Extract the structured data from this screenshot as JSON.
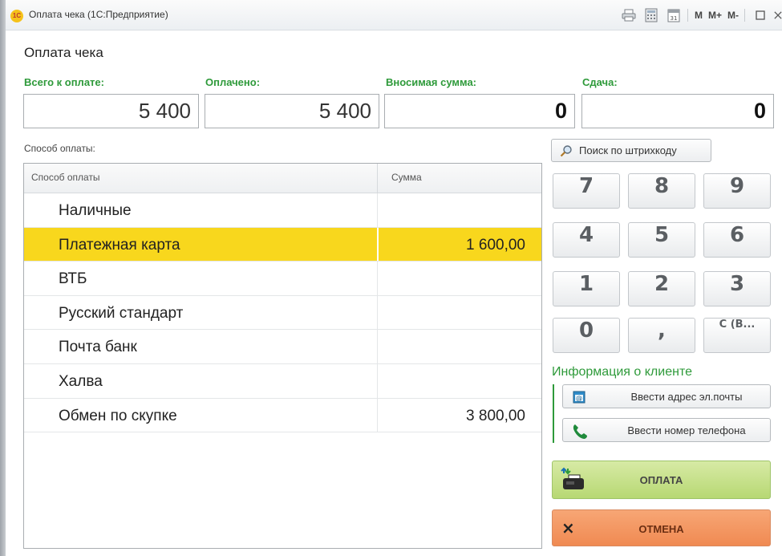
{
  "window": {
    "title": "Оплата чека  (1С:Предприятие)",
    "logo_text": "1С",
    "toolbar": [
      "print-icon",
      "calculator-icon",
      "calendar-icon"
    ],
    "memory": {
      "m": "M",
      "mplus": "M+",
      "mminus": "M-"
    },
    "maximize_icon": "maximize-icon",
    "close_icon": "close-icon"
  },
  "page": {
    "title": "Оплата чека"
  },
  "totals": {
    "total_label": "Всего к оплате:",
    "total_value": "5 400",
    "paid_label": "Оплачено:",
    "paid_value": "5 400",
    "deposit_label": "Вносимая сумма:",
    "deposit_value": "0",
    "change_label": "Сдача:",
    "change_value": "0"
  },
  "payment": {
    "section_label": "Способ оплаты:",
    "columns": {
      "method": "Способ оплаты",
      "amount": "Сумма"
    },
    "rows": [
      {
        "method": "Наличные",
        "amount": ""
      },
      {
        "method": "Платежная карта",
        "amount": "1 600,00",
        "selected": true
      },
      {
        "method": "ВТБ",
        "amount": ""
      },
      {
        "method": "Русский стандарт",
        "amount": ""
      },
      {
        "method": "Почта банк",
        "amount": ""
      },
      {
        "method": "Халва",
        "amount": ""
      },
      {
        "method": "Обмен по скупке",
        "amount": "3 800,00"
      }
    ]
  },
  "search": {
    "label": "Поиск по штрихкоду",
    "icon": "magnifier-icon"
  },
  "keypad": {
    "k7": "7",
    "k8": "8",
    "k9": "9",
    "k4": "4",
    "k5": "5",
    "k6": "6",
    "k1": "1",
    "k2": "2",
    "k3": "3",
    "k0": "0",
    "comma": ",",
    "clear": "С (В..."
  },
  "client": {
    "title": "Информация о клиенте",
    "email_button": "Ввести адрес эл.почты",
    "phone_button": "Ввести номер телефона"
  },
  "actions": {
    "pay": "ОПЛАТА",
    "cancel": "ОТМЕНА",
    "cancel_icon": "×"
  },
  "colors": {
    "accent_green": "#2e9a3a",
    "selected_row": "#f8d71d",
    "pay_button": "#c6e08a",
    "cancel_button": "#f39762"
  }
}
